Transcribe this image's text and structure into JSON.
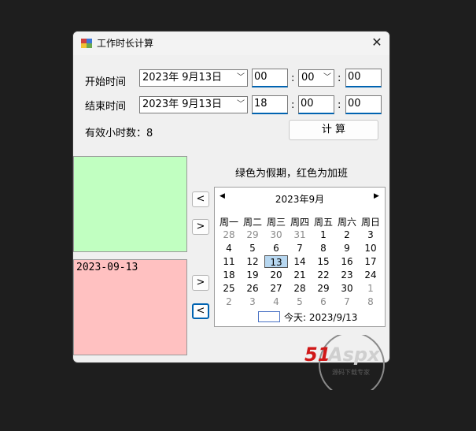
{
  "window": {
    "title": "工作时长计算"
  },
  "form": {
    "start": {
      "label": "开始时间",
      "date": "2023年  9月13日",
      "hour": "00",
      "minute": "00",
      "second": "00"
    },
    "end": {
      "label": "结束时间",
      "date": "2023年  9月13日",
      "hour": "18",
      "minute": "00",
      "second": "00"
    },
    "colon": ":",
    "effective_hours_label": "有效小时数：8",
    "calc_button": "计  算"
  },
  "hint": "绿色为假期，红色为加班",
  "holiday_list": [],
  "overtime_list": [
    "2023-09-13"
  ],
  "buttons": {
    "lt": "<",
    "gt": ">"
  },
  "calendar": {
    "month_label": "2023年9月",
    "weekdays": [
      "周一",
      "周二",
      "周三",
      "周四",
      "周五",
      "周六",
      "周日"
    ],
    "weeks": [
      [
        "28",
        "29",
        "30",
        "31",
        "1",
        "2",
        "3"
      ],
      [
        "4",
        "5",
        "6",
        "7",
        "8",
        "9",
        "10"
      ],
      [
        "11",
        "12",
        "13",
        "14",
        "15",
        "16",
        "17"
      ],
      [
        "18",
        "19",
        "20",
        "21",
        "22",
        "23",
        "24"
      ],
      [
        "25",
        "26",
        "27",
        "28",
        "29",
        "30",
        "1"
      ],
      [
        "2",
        "3",
        "4",
        "5",
        "6",
        "7",
        "8"
      ]
    ],
    "other_month": [
      [
        0,
        0
      ],
      [
        0,
        1
      ],
      [
        0,
        2
      ],
      [
        0,
        3
      ],
      [
        4,
        6
      ],
      [
        5,
        0
      ],
      [
        5,
        1
      ],
      [
        5,
        2
      ],
      [
        5,
        3
      ],
      [
        5,
        4
      ],
      [
        5,
        5
      ],
      [
        5,
        6
      ]
    ],
    "selected": [
      2,
      2
    ],
    "today_label": "今天: 2023/9/13"
  },
  "watermark": {
    "text": "51Aspx",
    "sub": "源码下载专家"
  },
  "colors": {
    "holiday_green": "#c1ffc1",
    "overtime_red": "#ffc1c1",
    "accent": "#0063b1"
  }
}
